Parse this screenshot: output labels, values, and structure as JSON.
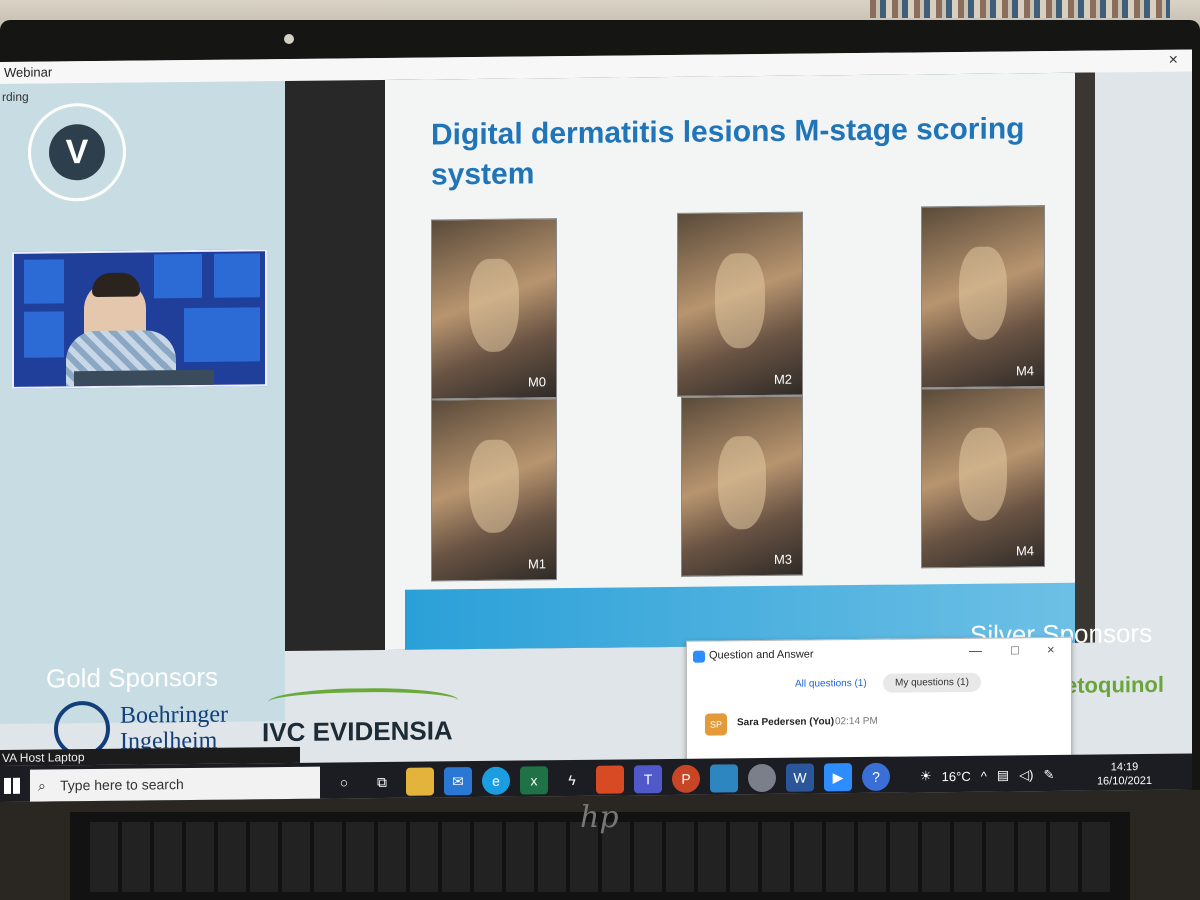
{
  "window": {
    "title": "Webinar",
    "close_glyph": "×"
  },
  "recording_label": "rding",
  "slide": {
    "title": "Digital dermatitis lesions M-stage scoring system",
    "photos": [
      {
        "label": "M0"
      },
      {
        "label": "M1"
      },
      {
        "label": "M2"
      },
      {
        "label": "M3"
      },
      {
        "label": "M4"
      },
      {
        "label": "M4"
      }
    ]
  },
  "sponsors": {
    "gold_heading": "Gold Sponsors",
    "boehringer_line1": "Boehringer",
    "boehringer_line2": "Ingelheim",
    "ivc": "IVC EVIDENSIA",
    "silver_heading": "Silver Sponsors",
    "vetoquinol": "etoquinol"
  },
  "qa": {
    "title": "Question and Answer",
    "tab_all": "All questions (1)",
    "tab_mine": "My questions (1)",
    "avatar": "SP",
    "user": "Sara Pedersen (You)",
    "time": "02:14 PM",
    "minimize": "—",
    "maximize": "□",
    "close": "×"
  },
  "host_label": "VA Host Laptop",
  "taskbar": {
    "search_placeholder": "Type here to search",
    "temperature": "16°C",
    "time": "14:19",
    "date": "16/10/2021"
  },
  "colors": {
    "slide_title": "#1f75b8",
    "side_panel": "#c7dde3",
    "taskbar": "#1b1d22",
    "accent": "#2d8cff"
  },
  "icons": [
    "windows-start-icon",
    "search-icon",
    "cortana-icon",
    "task-view-icon",
    "file-explorer-icon",
    "mail-icon",
    "edge-icon",
    "excel-icon",
    "office-icon",
    "teams-icon",
    "powerpoint-icon",
    "photos-icon",
    "paint-icon",
    "word-icon",
    "zoom-icon",
    "help-icon",
    "weather-icon"
  ]
}
